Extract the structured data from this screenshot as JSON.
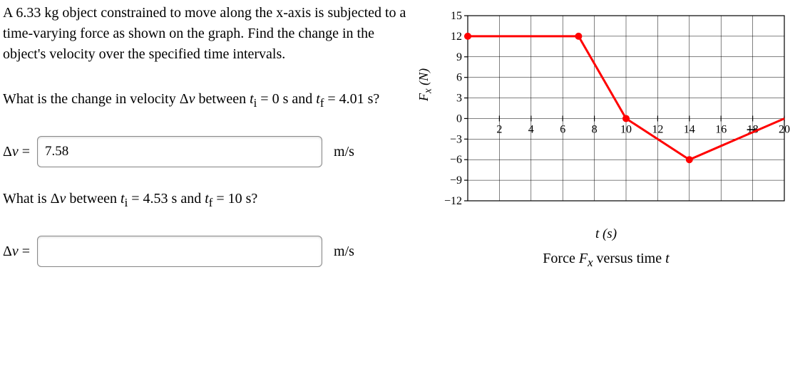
{
  "problem": {
    "text": "A 6.33 kg object constrained to move along the x-axis is subjected to a time-varying force as shown on the graph. Find the change in the object's velocity over the specified time intervals."
  },
  "q1": {
    "text_prefix": "What is the change in velocity Δ",
    "var": "v",
    "text_mid": " between ",
    "ti_label": "t",
    "ti_sub": "i",
    "ti_val": " = 0 s and ",
    "tf_label": "t",
    "tf_sub": "f",
    "tf_val": " = 4.01 s?"
  },
  "answer1": {
    "label_prefix": "Δ",
    "label_var": "v",
    "label_eq": " = ",
    "value": "7.58",
    "unit": "m/s"
  },
  "q2": {
    "text_prefix": "What is Δ",
    "var": "v",
    "text_mid": " between ",
    "ti_label": "t",
    "ti_sub": "i",
    "ti_val": " = 4.53 s and ",
    "tf_label": "t",
    "tf_sub": "f",
    "tf_val": " = 10 s?"
  },
  "answer2": {
    "label_prefix": "Δ",
    "label_var": "v",
    "label_eq": " = ",
    "value": "",
    "unit": "m/s"
  },
  "chart_data": {
    "type": "line",
    "title": "Force Fₓ versus time t",
    "xlabel": "t (s)",
    "ylabel": "Fₓ (N)",
    "xlim": [
      0,
      20
    ],
    "ylim": [
      -12,
      15
    ],
    "xticks": [
      2,
      4,
      6,
      8,
      10,
      12,
      14,
      16,
      18,
      20
    ],
    "yticks": [
      -12,
      -9,
      -6,
      -3,
      0,
      3,
      6,
      9,
      12,
      15
    ],
    "series": [
      {
        "name": "Fx",
        "color": "#ff0000",
        "points": [
          {
            "x": 0,
            "y": 12
          },
          {
            "x": 7,
            "y": 12
          },
          {
            "x": 10,
            "y": 0
          },
          {
            "x": 14,
            "y": -6
          },
          {
            "x": 20,
            "y": 0
          }
        ],
        "markers_at": [
          0,
          1,
          2,
          3
        ]
      }
    ],
    "gridlines_x": [
      0,
      2,
      4,
      6,
      8,
      10,
      12,
      14,
      16,
      18,
      20
    ],
    "gridlines_y": [
      -12,
      -9,
      -6,
      -3,
      0,
      3,
      6,
      9,
      12,
      15
    ]
  }
}
